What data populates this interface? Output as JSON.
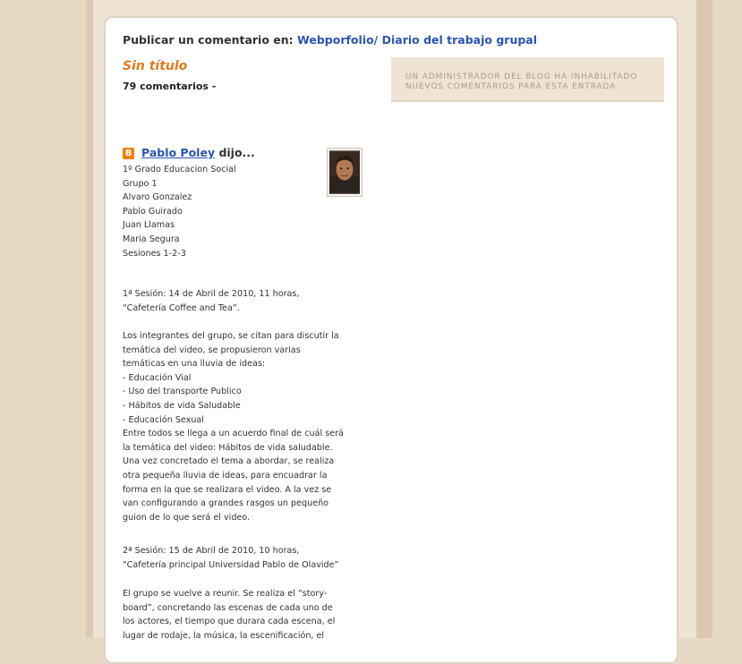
{
  "header": {
    "prefix": "Publicar un comentario en:",
    "blog_link": "Webporfolio/ Diario del trabajo grupal"
  },
  "post": {
    "title": "Sin título",
    "comment_count": "79 comentarios -"
  },
  "comments_disabled_notice": "UN ADMINISTRADOR DEL BLOG HA INHABILITADO NUEVOS COMENTARIOS PARA ESTA ENTRADA.",
  "comment": {
    "icon": "blogger-icon",
    "author": "Pablo Poley",
    "said": "dijo...",
    "avatar": "author-avatar",
    "group_info": [
      "1º Grado Educacion Social",
      "Grupo 1",
      "Alvaro Gonzalez",
      "Pablo Guirado",
      "Juan Llamas",
      "Maria Segura",
      "Sesiones 1-2-3"
    ],
    "session1_header": [
      "1ª Sesión: 14 de Abril de 2010, 11 horas,",
      "“Cafetería Coffee and Tea”."
    ],
    "session1_body": [
      "Los integrantes del grupo, se citan para discutir la",
      "temática del video, se propusieron varias",
      "temáticas en una lluvia de ideas:",
      "- Educación Vial",
      "- Uso del transporte Publico",
      "- Hábitos de vida Saludable",
      "- Educación Sexual",
      "Entre todos se llega a un acuerdo final de cuál será",
      "la temática del video: Hábitos de vida saludable.",
      "Una vez concretado el tema a abordar, se realiza",
      "otra pequeña lluvia de ideas, para encuadrar la",
      "forma en la que se realizara el video. A la vez se",
      "van configurando a grandes rasgos un pequeño",
      "guion de lo que será el video."
    ],
    "session2_header": [
      "2ª Sesión: 15 de Abril de 2010, 10 horas,",
      "“Cafetería principal Universidad Pablo de Olavide”"
    ],
    "session2_body": [
      "El grupo se vuelve a reunir. Se realiza el “story-",
      "board”, concretando las escenas de cada uno de",
      "los actores, el tiempo que durara cada escena, el",
      "lugar de rodaje, la música, la escenificación, el"
    ]
  }
}
